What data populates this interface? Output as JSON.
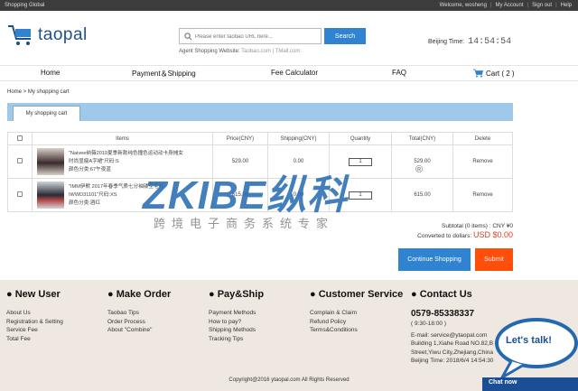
{
  "topbar": {
    "left": "Shopping Global",
    "welcome": "Welcome, wosheng",
    "account": "My Account",
    "signout": "Sign out",
    "help": "Help"
  },
  "brand": {
    "name": "taopal",
    "color": "#1f4e8c"
  },
  "search": {
    "placeholder": "Please enter taobao URL here...",
    "button": "Search",
    "agent_label": "Agent Shopping Website:",
    "agent_sites": "Taobao.com",
    "agent_sites2": "TMall.com"
  },
  "clock": {
    "label": "Beijing Time:",
    "time": "14:54:54"
  },
  "nav": {
    "home": "Home",
    "payment": "Payment＆Shipping",
    "fee": "Fee Calculator",
    "faq": "FAQ",
    "cart": "Cart ( 2 )"
  },
  "breadcrumb": "Home > My shopping cart",
  "tab": "My shopping cart",
  "table": {
    "headers": [
      "Items",
      "Price(CNY)",
      "Shipping(CNY)",
      "Quantity",
      "Total(CNY)",
      "Delete"
    ],
    "rows": [
      {
        "title": "\"Naivee纳薇2019夏季新款纯色撞色运动动卡身摊女",
        "title2": "时尚显瘦A字裙\"尺码:S",
        "variant": "颜色分类:67午夜蓝",
        "price": "529.00",
        "shipping": "0.00",
        "qty": "1",
        "total": "529.00",
        "delete": "Remove"
      },
      {
        "title": "\"IMM伊默 2017年春季气质七分袖镂空毛衫",
        "title2": "IWWD31101\"尺码:XS",
        "variant": "颜色分类:酒红",
        "price": "615.00",
        "shipping": "0.00",
        "qty": "1",
        "total": "615.00",
        "delete": "Remove"
      }
    ]
  },
  "subtotal": "Subtotal (0 items) : CNY ¥0",
  "converted_label": "Converted to dollars:",
  "converted_value": "USD $0.00",
  "buttons": {
    "continue": "Continue Shopping",
    "submit": "Submit"
  },
  "watermark": {
    "main": "ZKIBE纵科",
    "sub": "跨境电子商务系统专家",
    "reg": "®"
  },
  "footer": {
    "new_user": {
      "title": "● New User",
      "links": [
        "About Us",
        "Registration & Setting",
        "Service Fee",
        "Total Fee"
      ]
    },
    "make_order": {
      "title": "● Make Order",
      "links": [
        "Taobao Tips",
        "Order Process",
        "About \"Combine\""
      ]
    },
    "pay_ship": {
      "title": "● Pay&Ship",
      "links": [
        "Payment Methods",
        "How to pay?",
        "Shipping Methods",
        "Tracking Tips"
      ]
    },
    "customer": {
      "title": "● Customer Service",
      "links": [
        "Complain & Claim",
        "Refund Policy",
        "Terms&Conditions"
      ]
    },
    "contact": {
      "title": "● Contact Us",
      "phone": "0579-85338337",
      "hours": "( 9:30-18:00 )",
      "email": "E-mail: service@ytaopal.com",
      "addr1": "Building 1,Xiahe Road NO.82,B",
      "addr2": "Street,Yiwu City,Zhejiang,China",
      "bjtime": "Beijing Time: 2018/6/4 14:54:30"
    },
    "copyright": "Copyright@2016 ytaopal.com All Rights Reserved"
  },
  "chat": {
    "bubble": "Let's talk!",
    "bar": "Chat now"
  },
  "colors": {
    "accent": "#2f83d0",
    "submit": "#ff4d0a",
    "tabbar": "#9fc9ea",
    "footer_bg": "#eee8e1"
  }
}
